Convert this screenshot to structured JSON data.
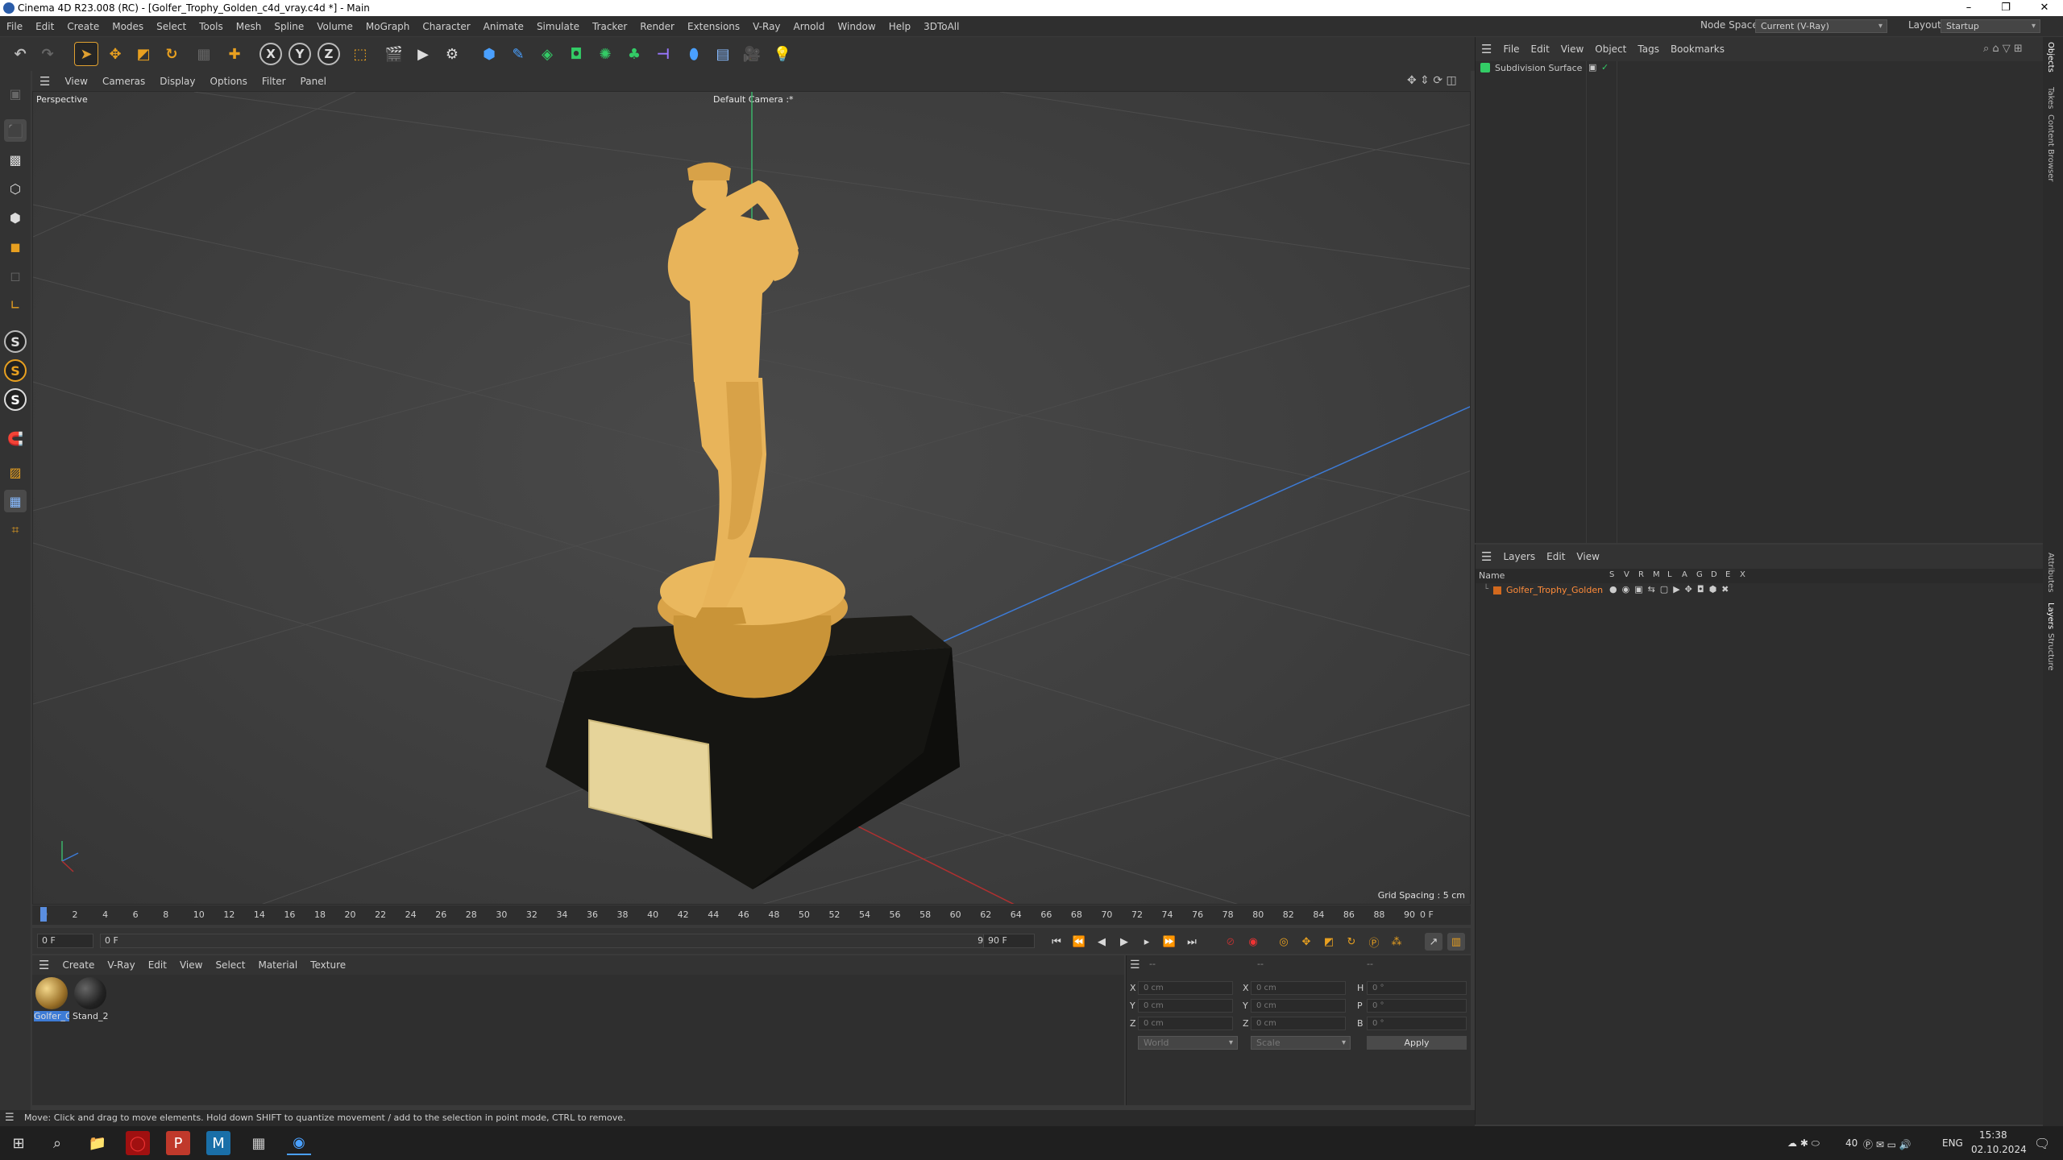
{
  "titlebar": {
    "title": "Cinema 4D R23.008 (RC) - [Golfer_Trophy_Golden_c4d_vray.c4d *] - Main",
    "minimize": "–",
    "restore": "❐",
    "close": "✕"
  },
  "menubar": {
    "items": [
      "File",
      "Edit",
      "Create",
      "Modes",
      "Select",
      "Tools",
      "Mesh",
      "Spline",
      "Volume",
      "MoGraph",
      "Character",
      "Animate",
      "Simulate",
      "Tracker",
      "Render",
      "Extensions",
      "V-Ray",
      "Arnold",
      "Window",
      "Help",
      "3DToAll"
    ],
    "node_space_label": "Node Space:",
    "node_space_value": "Current (V-Ray)",
    "layout_label": "Layout:",
    "layout_value": "Startup"
  },
  "toolbar": {
    "axis_x": "X",
    "axis_y": "Y",
    "axis_z": "Z"
  },
  "lefttools": {
    "s1": "S",
    "s2": "S",
    "s3": "S"
  },
  "viewport": {
    "menu": [
      "View",
      "Cameras",
      "Display",
      "Options",
      "Filter",
      "Panel"
    ],
    "mode_label": "Perspective",
    "camera_label": "Default Camera :*",
    "grid_spacing": "Grid Spacing : 5 cm"
  },
  "timeline": {
    "ticks": [
      "0",
      "2",
      "4",
      "6",
      "8",
      "10",
      "12",
      "14",
      "16",
      "18",
      "20",
      "22",
      "24",
      "26",
      "28",
      "30",
      "32",
      "34",
      "36",
      "38",
      "40",
      "42",
      "44",
      "46",
      "48",
      "50",
      "52",
      "54",
      "56",
      "58",
      "60",
      "62",
      "64",
      "66",
      "68",
      "70",
      "72",
      "74",
      "76",
      "78",
      "80",
      "82",
      "84",
      "86",
      "88",
      "90"
    ],
    "current_frame": "0 F",
    "start_field": "0 F",
    "range_start": "0 F",
    "range_end": "90 F",
    "end_field": "90 F"
  },
  "materials": {
    "menu": [
      "Create",
      "V-Ray",
      "Edit",
      "View",
      "Select",
      "Material",
      "Texture"
    ],
    "items": [
      {
        "name": "Golfer_G",
        "color": "#b08a3a"
      },
      {
        "name": "Stand_2",
        "color": "#2a2a2a"
      }
    ]
  },
  "coordinates": {
    "head1": "--",
    "head2": "--",
    "head3": "--",
    "rows": [
      {
        "a": "X",
        "av": "0 cm",
        "b": "X",
        "bv": "0 cm",
        "c": "H",
        "cv": "0 °"
      },
      {
        "a": "Y",
        "av": "0 cm",
        "b": "Y",
        "bv": "0 cm",
        "c": "P",
        "cv": "0 °"
      },
      {
        "a": "Z",
        "av": "0 cm",
        "b": "Z",
        "bv": "0 cm",
        "c": "B",
        "cv": "0 °"
      }
    ],
    "mode": "World",
    "scale": "Scale",
    "apply": "Apply"
  },
  "status": {
    "text": "Move: Click and drag to move elements. Hold down SHIFT to quantize movement / add to the selection in point mode, CTRL to remove."
  },
  "objects": {
    "menu": [
      "File",
      "Edit",
      "View",
      "Object",
      "Tags",
      "Bookmarks"
    ],
    "items": [
      {
        "name": "Subdivision Surface"
      }
    ]
  },
  "layers": {
    "menu": [
      "Layers",
      "Edit",
      "View"
    ],
    "name_header": "Name",
    "flags": [
      "S",
      "V",
      "R",
      "M",
      "L",
      "A",
      "G",
      "D",
      "E",
      "X"
    ],
    "items": [
      {
        "name": "Golfer_Trophy_Golden",
        "color": "#d2691e"
      }
    ]
  },
  "sidetabs": [
    "Objects",
    "Takes",
    "Content Browser",
    "Attributes",
    "Layers",
    "Structure"
  ],
  "taskbar": {
    "tray_num": "40",
    "lang": "ENG",
    "time": "15:38",
    "date": "02.10.2024"
  },
  "colors": {
    "gold": "#e8b45a",
    "accent_blue": "#3d7bd6",
    "layer_orange": "#d2691e"
  }
}
